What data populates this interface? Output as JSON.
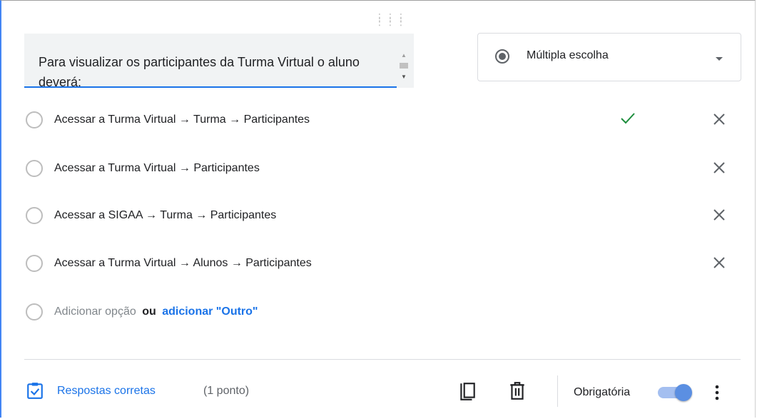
{
  "question": {
    "text": "Para visualizar os participantes da Turma Virtual o aluno deverá:"
  },
  "type_selector": {
    "selected": "Múltipla escolha",
    "icon": "radio-button-icon"
  },
  "options": [
    {
      "label": "Acessar a Turma Virtual → Turma → Participantes",
      "correct": true
    },
    {
      "label": "Acessar a Turma Virtual → Participantes",
      "correct": false
    },
    {
      "label": "Acessar a SIGAA → Turma → Participantes",
      "correct": false
    },
    {
      "label": "Acessar a Turma Virtual → Alunos → Participantes",
      "correct": false
    }
  ],
  "add_option": {
    "label": "Adicionar opção",
    "or_text": "ou",
    "other_link": "adicionar \"Outro\""
  },
  "footer": {
    "answer_key_label": "Respostas corretas",
    "points_label": "(1 ponto)",
    "required_label": "Obrigatória",
    "required_on": true
  },
  "colors": {
    "accent": "#1a73e8",
    "check": "#1e8e3e",
    "border_active": "#4285f4"
  }
}
